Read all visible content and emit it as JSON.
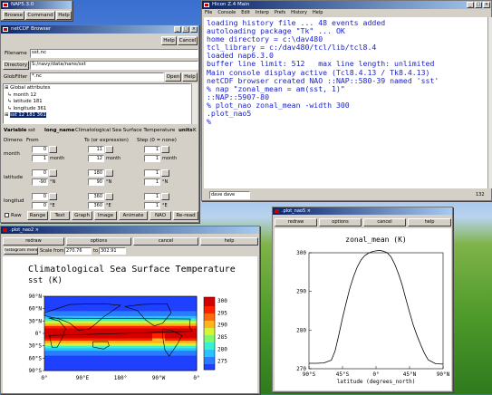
{
  "nap_small": {
    "title": "NAP5.3.0",
    "buttons": [
      "Browse",
      "Command",
      "Help"
    ]
  },
  "netcdf": {
    "title": "netCDF Browser",
    "help": "Help",
    "cancel": "Cancel",
    "filename_label": "Filename",
    "filename": "sst.nc",
    "directory_label": "Directory",
    "directory": "S:/navy/data/nans/sst",
    "globfilter_label": "GlobFilter",
    "globfilter": "*.nc",
    "open": "Open",
    "help2": "Help",
    "tree": [
      "Global attributes",
      "month  12",
      "latitude  181",
      "longitude  361",
      "sst  12 181 361"
    ],
    "var_label": "Variable",
    "var": "sst",
    "long_name_label": "long_name",
    "long_name": "Climatological Sea Surface Temperature",
    "units_label": "units",
    "units": "K",
    "col_dims": "Dimens",
    "col_from": "From",
    "col_to": "To (or expression)",
    "col_step": "Step (0 = none)",
    "rows": [
      {
        "name": "month",
        "from": "0",
        "from2": "1",
        "fromu": "month",
        "to": "11",
        "to2": "12",
        "tou": "month",
        "step": "1",
        "step2": "1",
        "stepu": "month"
      },
      {
        "name": "latitude",
        "from": "0",
        "from2": "-90",
        "fromu": "°N",
        "to": "180",
        "to2": "90",
        "tou": "°N",
        "step": "1",
        "step2": "1",
        "stepu": "°N"
      },
      {
        "name": "longitud",
        "from": "0",
        "from2": "0",
        "fromu": "°E",
        "to": "360",
        "to2": "360",
        "tou": "°E",
        "step": "1",
        "step2": "1",
        "stepu": "°E"
      }
    ],
    "bottom": [
      "Raw",
      "Range",
      "Text",
      "Graph",
      "Image",
      "Animate",
      "NAO",
      "Re-read"
    ]
  },
  "console": {
    "title": "Hicon Z.4 Main",
    "menu": [
      "File",
      "Console",
      "Edit",
      "Interp",
      "Prefs",
      "History",
      "Help"
    ],
    "lines": [
      "loading history file ... 48 events added",
      "autoloading package \"Tk\" ... OK",
      "home directory = c:\\dav480",
      "tcl_library = c:/dav480/tcl/lib/tcl8.4",
      "loaded nap6.3.0",
      "buffer line limit: 512   max line length: unlimited",
      "Main console display active (Tcl8.4.13 / Tk8.4.13)",
      "netCDF browser created NAO ::NAP::580-39 named 'sst'",
      "% nap \"zonal_mean = am(sst, 1)\"",
      "::NAP::5907-80",
      "% plot_nao zonal_mean -width 300",
      ".plot_nao5",
      "%"
    ],
    "status_left": "dave dave",
    "status_right": "132"
  },
  "plot2": {
    "title": ".plot_nao2",
    "buttons": [
      "redraw",
      "options",
      "cancel",
      "help"
    ],
    "hist": "histogram menu",
    "scale_from_label": "Scale from",
    "scale_from": "270.76",
    "scale_to_label": "to",
    "scale_to": "302.91",
    "chart_title": "Climatological Sea Surface Temperature",
    "chart_sub": "sst (K)",
    "y_ticks": [
      "90°N",
      "60°N",
      "30°N",
      "0°",
      "30°S",
      "60°S",
      "90°S"
    ],
    "x_ticks": [
      "0°",
      "90°E",
      "180°",
      "90°W",
      "0°"
    ],
    "cbar_ticks": [
      "300",
      "295",
      "290",
      "285",
      "280",
      "275"
    ]
  },
  "plot5": {
    "title": ".plot_nao5",
    "buttons": [
      "redraw",
      "options",
      "cancel",
      "help"
    ]
  },
  "chart_data": {
    "type": "line",
    "title": "zonal_mean (K)",
    "xlabel": "latitude (degrees_north)",
    "ylabel": "",
    "x": [
      -90,
      -80,
      -70,
      -60,
      -55,
      -50,
      -45,
      -40,
      -35,
      -30,
      -25,
      -20,
      -15,
      -10,
      -5,
      0,
      5,
      10,
      15,
      20,
      25,
      30,
      35,
      40,
      45,
      50,
      55,
      60,
      65,
      70,
      80,
      90
    ],
    "values": [
      271.4,
      271.4,
      271.5,
      272.2,
      274.6,
      278.7,
      283.1,
      287.1,
      290.9,
      293.9,
      296.4,
      298.2,
      299.3,
      299.9,
      300.3,
      300.5,
      300.6,
      300.4,
      300.0,
      299.0,
      297.1,
      294.6,
      291.7,
      288.1,
      284.6,
      281.3,
      278.6,
      276.2,
      274.0,
      272.3,
      271.3,
      271.2
    ],
    "xlim": [
      -90,
      90
    ],
    "ylim": [
      270,
      300
    ],
    "x_ticks": [
      "90°S",
      "45°S",
      "0°",
      "45°N",
      "90°N"
    ],
    "y_ticks": [
      "300",
      "290",
      "280",
      "270"
    ],
    "colors": {
      "line": "#000000"
    }
  }
}
